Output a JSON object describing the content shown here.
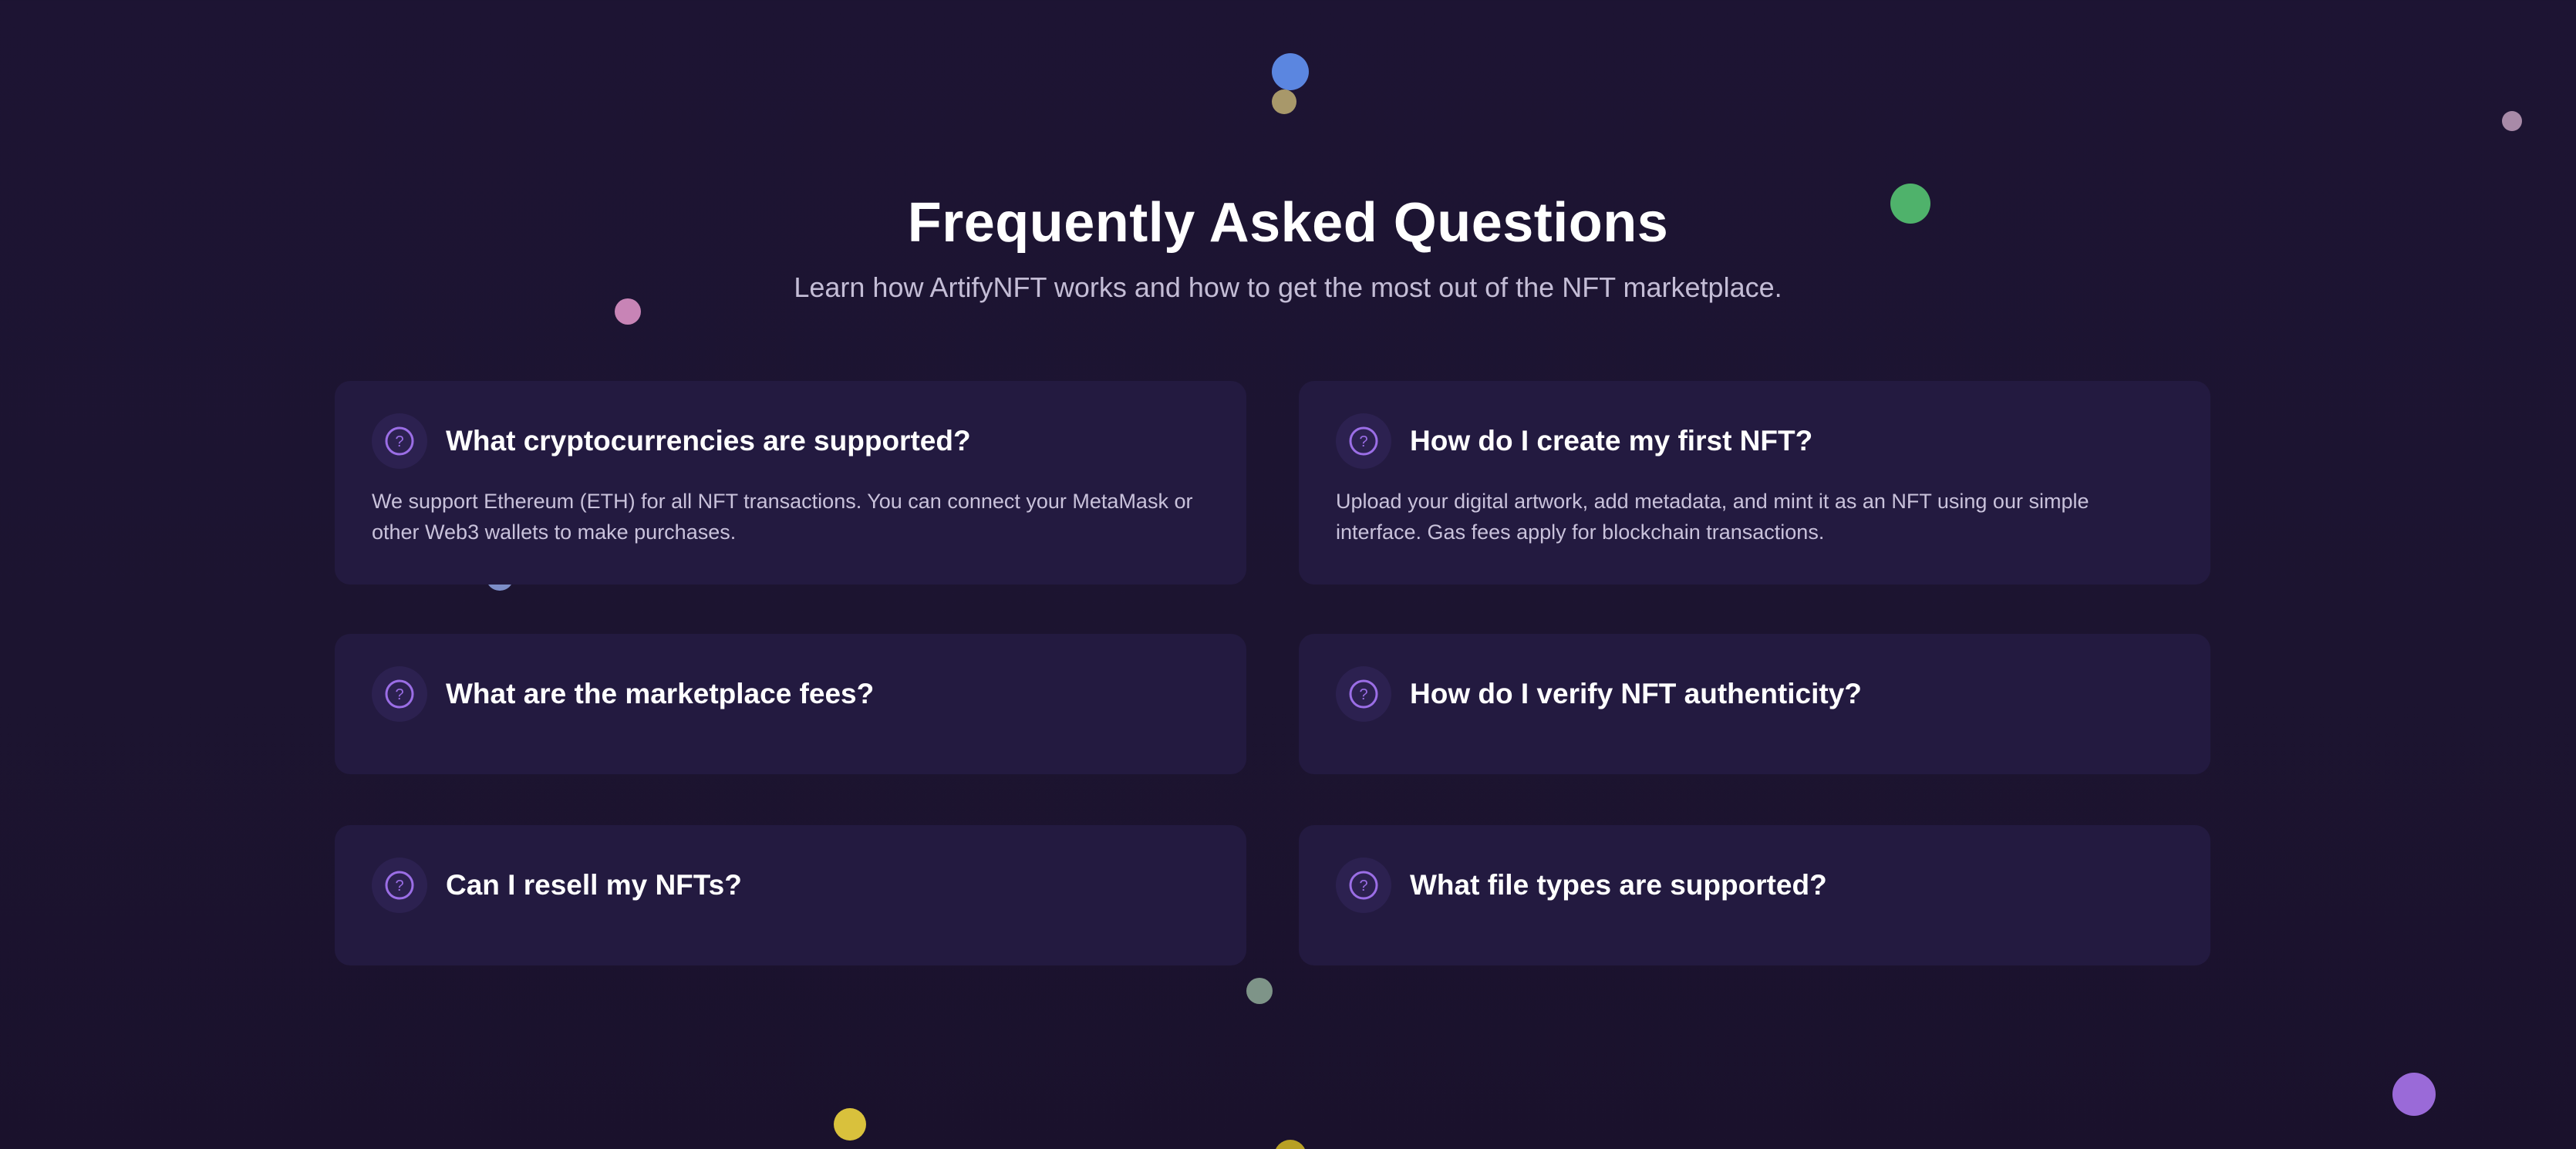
{
  "header": {
    "title": "Frequently Asked Questions",
    "subtitle": "Learn how ArtifyNFT works and how to get the most out of the NFT marketplace."
  },
  "faq": [
    {
      "question": "What cryptocurrencies are supported?",
      "answer": "We support Ethereum (ETH) for all NFT transactions. You can connect your MetaMask or other Web3 wallets to make purchases.",
      "expanded": true
    },
    {
      "question": "How do I create my first NFT?",
      "answer": "Upload your digital artwork, add metadata, and mint it as an NFT using our simple interface. Gas fees apply for blockchain transactions.",
      "expanded": true
    },
    {
      "question": "What are the marketplace fees?",
      "answer": "",
      "expanded": false
    },
    {
      "question": "How do I verify NFT authenticity?",
      "answer": "",
      "expanded": false
    },
    {
      "question": "Can I resell my NFTs?",
      "answer": "",
      "expanded": false
    },
    {
      "question": "What file types are supported?",
      "answer": "",
      "expanded": false
    }
  ],
  "icons": {
    "question": "question-circle-icon"
  },
  "colors": {
    "background": "#1c1430",
    "card": "#231a40",
    "accent": "#9b6ee6",
    "subtitle": "#c4bdd6"
  }
}
